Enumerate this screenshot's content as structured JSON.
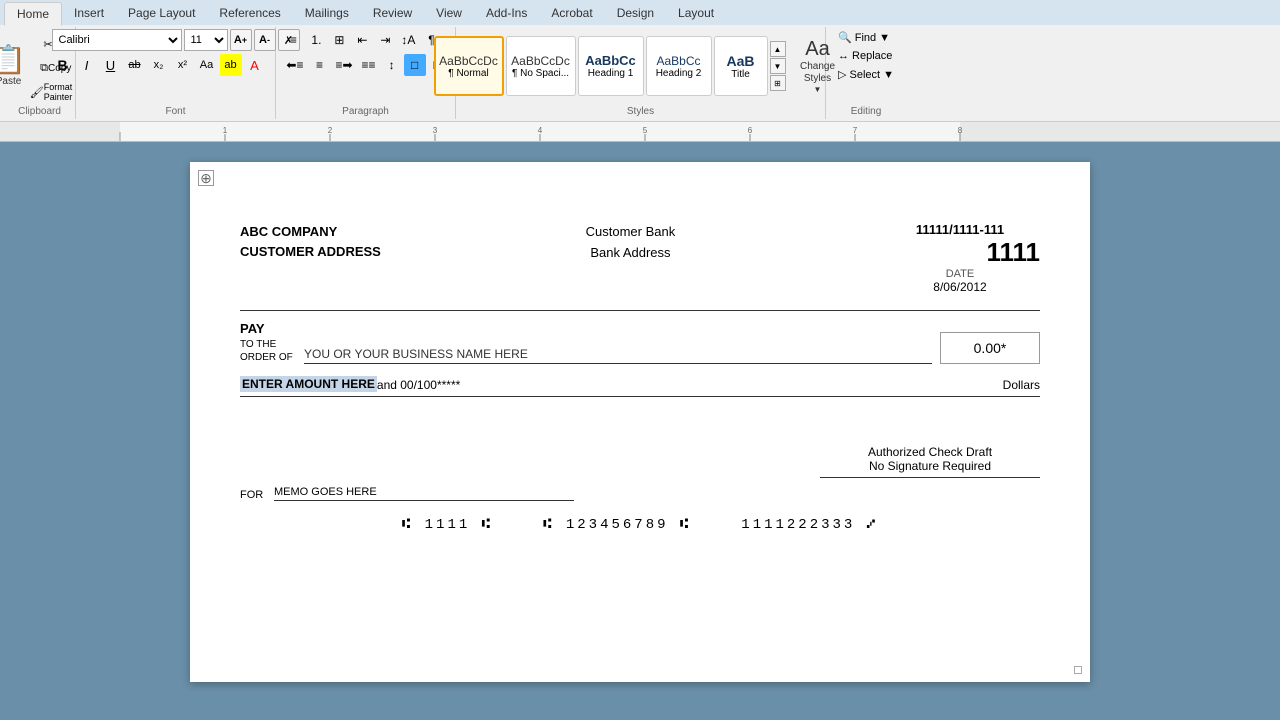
{
  "ribbon": {
    "tabs": [
      "Home",
      "Insert",
      "Page Layout",
      "References",
      "Mailings",
      "Review",
      "View",
      "Add-Ins",
      "Acrobat",
      "Design",
      "Layout"
    ],
    "active_tab": "Home",
    "clipboard": {
      "paste_label": "Paste",
      "cut_label": "Cut",
      "copy_label": "Copy",
      "format_painter_label": "Format Painter"
    },
    "font": {
      "name": "Calibri",
      "size": "11",
      "grow_label": "A",
      "shrink_label": "A",
      "clear_label": "✗",
      "bold_label": "B",
      "italic_label": "I",
      "underline_label": "U",
      "strikethrough_label": "ab",
      "subscript_label": "x₂",
      "superscript_label": "x²",
      "case_label": "Aa",
      "highlight_label": "ab",
      "color_label": "A",
      "group_label": "Font"
    },
    "paragraph": {
      "bullets_label": "≡",
      "numbering_label": "1.",
      "multilevel_label": "≡",
      "decrease_indent_label": "←",
      "increase_indent_label": "→",
      "sort_label": "↕",
      "pilcrow_label": "¶",
      "align_left_label": "≡",
      "align_center_label": "≡",
      "align_right_label": "≡",
      "justify_label": "≡",
      "line_spacing_label": "↕",
      "shading_label": "□",
      "borders_label": "□",
      "group_label": "Paragraph"
    },
    "styles": {
      "items": [
        {
          "label": "¶ Normal",
          "sublabel": "Normal",
          "active": true
        },
        {
          "label": "¶ No Spaci...",
          "sublabel": "No Spacing",
          "active": false
        },
        {
          "label": "Heading 1",
          "sublabel": "Heading 1",
          "active": false
        },
        {
          "label": "Heading 2",
          "sublabel": "Heading 2",
          "active": false
        },
        {
          "label": "Title",
          "sublabel": "Title",
          "active": false
        }
      ],
      "change_styles_label": "Change Styles",
      "group_label": "Styles"
    },
    "editing": {
      "find_label": "Find",
      "replace_label": "Replace",
      "select_label": "Select",
      "group_label": "Editing"
    }
  },
  "document": {
    "company_name": "ABC COMPANY",
    "company_address": "CUSTOMER ADDRESS",
    "bank_name": "Customer Bank",
    "bank_address": "Bank Address",
    "routing_number": "11111/1111-111",
    "check_number": "1111",
    "date_label": "DATE",
    "date_value": "8/06/2012",
    "pay_label": "PAY",
    "to_the_label": "TO THE",
    "order_of_label": "ORDER OF",
    "payee_placeholder": "YOU OR YOUR BUSINESS NAME HERE",
    "amount_value": "0.00*",
    "amount_text_selected": "ENTER AMOUNT HERE",
    "amount_text_rest": " and 00/100*****",
    "dollars_label": "Dollars",
    "authorized_line1": "Authorized Check Draft",
    "authorized_line2": "No Signature Required",
    "for_label": "FOR",
    "memo_placeholder": "MEMO GOES HERE",
    "micr_routing": "⑆ 1111 ⑆",
    "micr_account": "⑆ 123456789 ⑆",
    "micr_check": "1111222333 ⑇"
  }
}
